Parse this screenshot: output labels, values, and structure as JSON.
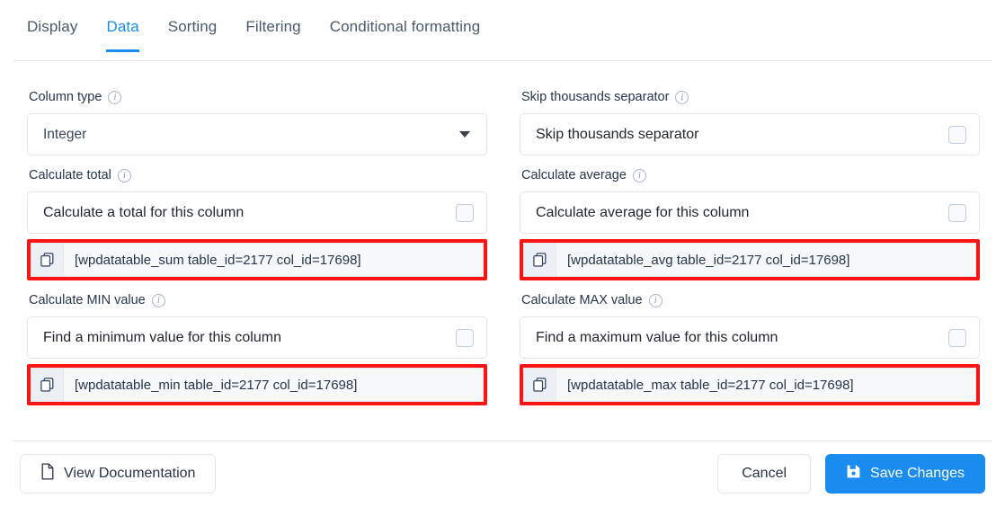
{
  "tabs": [
    {
      "label": "Display",
      "active": false
    },
    {
      "label": "Data",
      "active": true
    },
    {
      "label": "Sorting",
      "active": false
    },
    {
      "label": "Filtering",
      "active": false
    },
    {
      "label": "Conditional formatting",
      "active": false
    }
  ],
  "fields": {
    "column_type": {
      "label": "Column type",
      "value": "Integer",
      "info_icon": "info-icon",
      "caret_icon": "chevron-down-icon"
    },
    "skip_thousands": {
      "label": "Skip thousands separator",
      "checkbox_label": "Skip thousands separator",
      "checked": false,
      "info_icon": "info-icon"
    },
    "calculate_total": {
      "label": "Calculate total",
      "checkbox_label": "Calculate a total for this column",
      "checked": false,
      "info_icon": "info-icon",
      "shortcode": "[wpdatatable_sum table_id=2177 col_id=17698]",
      "copy_icon": "copy-icon",
      "highlighted": true
    },
    "calculate_average": {
      "label": "Calculate average",
      "checkbox_label": "Calculate average for this column",
      "checked": false,
      "info_icon": "info-icon",
      "shortcode": "[wpdatatable_avg table_id=2177 col_id=17698]",
      "copy_icon": "copy-icon",
      "highlighted": true
    },
    "calculate_min": {
      "label": "Calculate MIN value",
      "checkbox_label": "Find a minimum value for this column",
      "checked": false,
      "info_icon": "info-icon",
      "shortcode": "[wpdatatable_min table_id=2177 col_id=17698]",
      "copy_icon": "copy-icon",
      "highlighted": true
    },
    "calculate_max": {
      "label": "Calculate MAX value",
      "checkbox_label": "Find a maximum value for this column",
      "checked": false,
      "info_icon": "info-icon",
      "shortcode": "[wpdatatable_max table_id=2177 col_id=17698]",
      "copy_icon": "copy-icon",
      "highlighted": true
    }
  },
  "footer": {
    "view_documentation": "View Documentation",
    "doc_icon": "document-icon",
    "cancel": "Cancel",
    "save": "Save Changes",
    "save_icon": "save-disk-icon"
  },
  "colors": {
    "accent": "#1a8cf0",
    "highlight": "#fc1414",
    "label_text": "#27364b",
    "border": "#e3e6ea"
  }
}
